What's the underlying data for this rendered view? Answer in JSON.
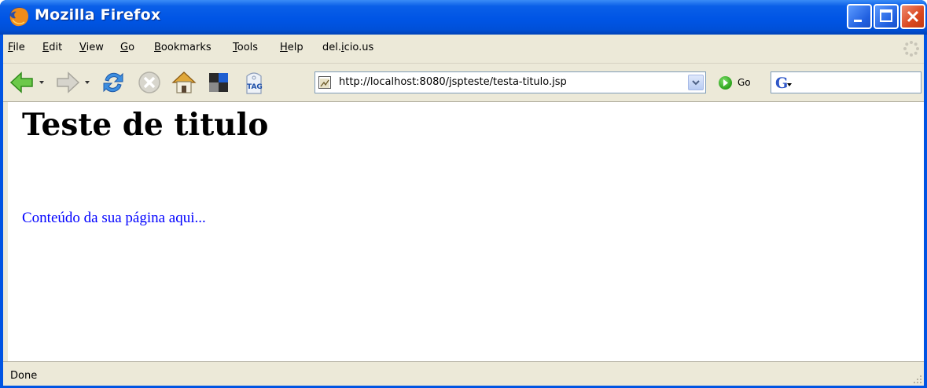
{
  "window": {
    "title": "Mozilla Firefox"
  },
  "menubar": {
    "items": [
      {
        "label": "File",
        "access_key": "F"
      },
      {
        "label": "Edit",
        "access_key": "E"
      },
      {
        "label": "View",
        "access_key": "V"
      },
      {
        "label": "Go",
        "access_key": "G"
      },
      {
        "label": "Bookmarks",
        "access_key": "B"
      },
      {
        "label": "Tools",
        "access_key": "T"
      },
      {
        "label": "Help",
        "access_key": "H"
      },
      {
        "label": "del.icio.us",
        "access_key": "i"
      }
    ]
  },
  "toolbar": {
    "buttons": [
      "back-icon",
      "forward-icon",
      "reload-icon",
      "stop-icon",
      "home-icon",
      "bookmark-manager-icon",
      "tag-icon"
    ],
    "tag_label": "TAG",
    "url": "http://localhost:8080/jspteste/testa-titulo.jsp",
    "go_label": "Go",
    "search_engine": "google-icon",
    "search_value": ""
  },
  "page": {
    "heading": "Teste de titulo",
    "paragraph": "Conteúdo da sua página aqui..."
  },
  "statusbar": {
    "text": "Done"
  },
  "colors": {
    "titlebar": "#0054e3",
    "chrome": "#ece9d8",
    "link_text": "#0000ff"
  }
}
